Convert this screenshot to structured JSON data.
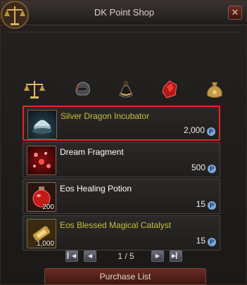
{
  "window": {
    "title": "DK Point Shop",
    "close_label": "✕"
  },
  "tabs": [
    {
      "name": "scales"
    },
    {
      "name": "helmet"
    },
    {
      "name": "potion-flask"
    },
    {
      "name": "ruby-gem"
    },
    {
      "name": "money-bag"
    }
  ],
  "items": [
    {
      "name": "Silver Dragon Incubator",
      "price": "2,000",
      "qty": "",
      "name_color": "#c6c23a",
      "selected": true
    },
    {
      "name": "Dream Fragment",
      "price": "500",
      "qty": "",
      "name_color": "#ffffff",
      "selected": false
    },
    {
      "name": "Eos Healing Potion",
      "price": "15",
      "qty": "200",
      "name_color": "#ffffff",
      "selected": false
    },
    {
      "name": "Eos Blessed Magical Catalyst",
      "price": "15",
      "qty": "1,000",
      "name_color": "#c6c23a",
      "selected": false
    }
  ],
  "currency_icon": "P",
  "pager": {
    "page_text": "1 / 5"
  },
  "footer": {
    "purchase_list_label": "Purchase List"
  },
  "colors": {
    "selection_border": "#e5242a",
    "highlight_name": "#c6c23a",
    "coin": "#7ca8d8"
  }
}
